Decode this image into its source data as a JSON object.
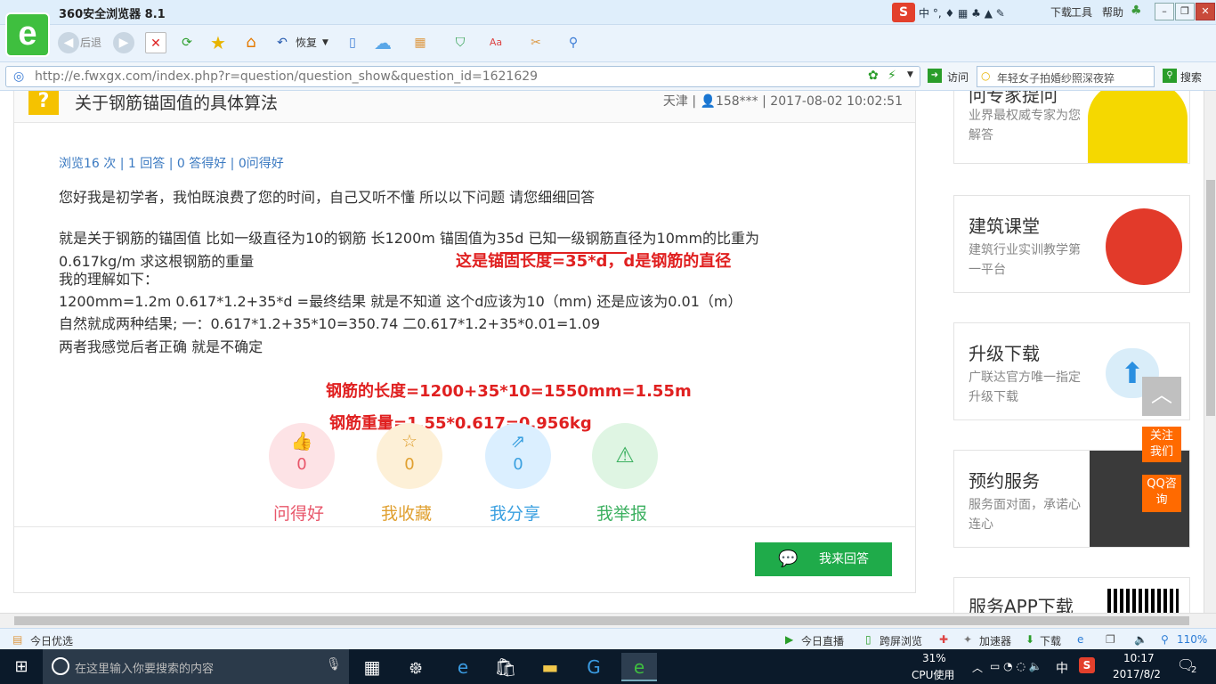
{
  "window": {
    "title": "360安全浏览器 8.1",
    "menu": [
      "下载",
      "工具",
      "帮助"
    ],
    "controls": {
      "minimize": "–",
      "maximize": "❐",
      "close": "✕"
    }
  },
  "toolbar": {
    "back_label": "后退",
    "restore_label": "恢复"
  },
  "address": {
    "url": "http://e.fwxgx.com/index.php?r=question/question_show&question_id=1621629",
    "visit_label": "访问",
    "search_value": "年轻女子拍婚纱照深夜猝",
    "search_label": "搜索"
  },
  "question": {
    "title": "关于钢筋锚固值的具体算法",
    "location": "天津",
    "user": "158***",
    "datetime": "2017-08-02 10:02:51",
    "stats": "浏览16 次 | 1 回答 | 0 答得好 | 0问得好",
    "paragraphs": [
      "您好我是初学者，我怕既浪费了您的时间，自己又听不懂      所以以下问题 请您细细回答",
      "就是关于钢筋的锚固值    比如一级直径为10的钢筋   长1200m   锚固值为35d     已知一级钢筋直径为10mm的比重为",
      "0.617kg/m     求这根钢筋的重量",
      "我的理解如下：",
      "1200mm=1.2m       0.617*1.2+35*d   =最终结果     就是不知道  这个d应该为10（mm) 还是应该为0.01（m）",
      "自然就成两种结果;    一：0.617*1.2+35*10=350.74      二0.617*1.2+35*0.01=1.09",
      "两者我感觉后者正确   就是不确定"
    ],
    "annotations": [
      "这是锚固长度=35*d，d是钢筋的直径",
      "钢筋的长度=1200+35*10=1550mm=1.55m",
      "钢筋重量=1.55*0.617=0.956kg"
    ],
    "actions": [
      {
        "label": "问得好",
        "count": "0",
        "icon": "thumbs-up-icon",
        "color": "#e8566a",
        "bg": "#fde3e6"
      },
      {
        "label": "我收藏",
        "count": "0",
        "icon": "star-icon",
        "color": "#e0a030",
        "bg": "#fdf0d7"
      },
      {
        "label": "我分享",
        "count": "0",
        "icon": "share-icon",
        "color": "#3aa0e0",
        "bg": "#dbefff"
      },
      {
        "label": "我举报",
        "count": "",
        "icon": "warning-icon",
        "color": "#3cb060",
        "bg": "#dff5e3"
      }
    ],
    "answer_button": "我来回答"
  },
  "sidebar": [
    {
      "title": "问专家提问",
      "sub": "业界最权威专家为您解答"
    },
    {
      "title": "建筑课堂",
      "sub": "建筑行业实训教学第一平台"
    },
    {
      "title": "升级下载",
      "sub": "广联达官方唯一指定升级下载"
    },
    {
      "title": "预约服务",
      "sub": "服务面对面，承诺心连心"
    },
    {
      "title": "服务APP下载",
      "sub": ""
    }
  ],
  "float": {
    "follow": "关注我们",
    "qq": "QQ咨询"
  },
  "statusbar": {
    "left": "今日优选",
    "items": [
      "今日直播",
      "跨屏浏览",
      "加速器",
      "下载"
    ],
    "zoom": "110%"
  },
  "taskbar": {
    "search_placeholder": "在这里输入你要搜索的内容",
    "cpu_percent": "31%",
    "cpu_label": "CPU使用",
    "ime": "中",
    "time": "10:17",
    "date": "2017/8/2",
    "notifications": "2"
  }
}
